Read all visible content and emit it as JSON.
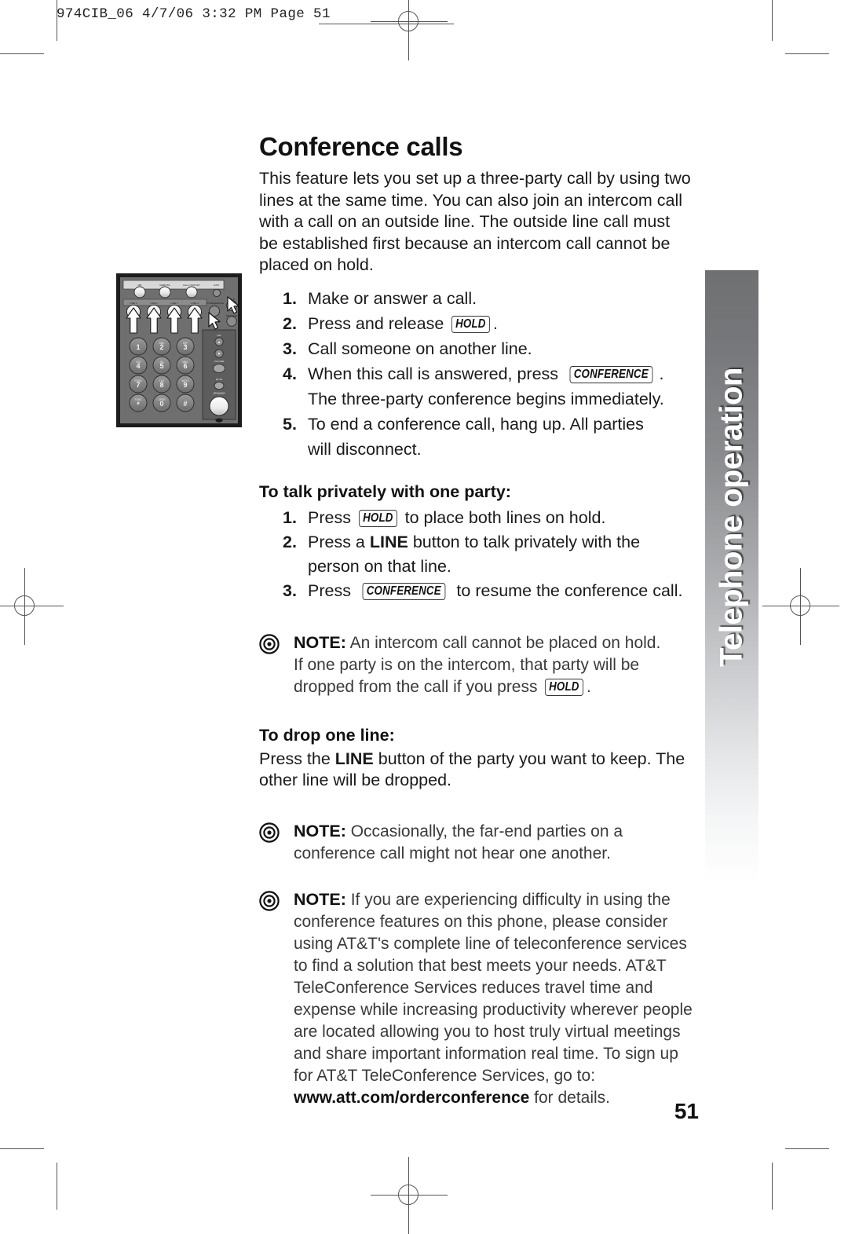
{
  "print_slug": "974CIB_06  4/7/06  3:32 PM  Page 51",
  "page_number": "51",
  "side_tab": {
    "label": "Telephone operation"
  },
  "article": {
    "title": "Conference calls",
    "intro": "This feature lets you set up a three-party call by using two lines at the same time. You can also join an intercom call with a call on an outside line. The outside line call must be established first because an intercom call cannot be placed on hold.",
    "steps": [
      {
        "num": "1.",
        "pre": "Make or answer a call.",
        "key": "",
        "post": ""
      },
      {
        "num": "2.",
        "pre": "Press and release ",
        "key": "HOLD",
        "post": "."
      },
      {
        "num": "3.",
        "pre": "Call someone on another line.",
        "key": "",
        "post": ""
      },
      {
        "num": "4.",
        "pre": "When this call is answered, press ",
        "key": "CONFERENCE",
        "post": ".",
        "cont": "The three-party conference begins immediately."
      },
      {
        "num": "5.",
        "pre": "To end a conference call, hang up.  All parties",
        "key": "",
        "post": "",
        "cont": "will disconnect."
      }
    ],
    "private_heading": "To talk privately with one party:",
    "private_steps": [
      {
        "num": "1.",
        "pre": "Press ",
        "key": "HOLD",
        "post": " to place both lines on hold."
      },
      {
        "num": "2.",
        "pre": "Press a ",
        "strong": "LINE",
        "post": " button to talk privately with the",
        "cont": "person on that line."
      },
      {
        "num": "3.",
        "pre": "Press ",
        "key": "CONFERENCE",
        "post": " to resume the conference call."
      }
    ],
    "note_hold": {
      "label": "NOTE:",
      "line1": " An intercom call cannot be placed on hold.",
      "line2": "If one party is on the intercom,  that party will be",
      "line3_pre": "dropped from the call if you press ",
      "line3_key": "HOLD",
      "line3_post": "."
    },
    "drop_heading": "To drop one line:",
    "drop_body_pre": "Press the ",
    "drop_body_strong": "LINE",
    "drop_body_post": " button of the party you want to keep. The other line will be dropped.",
    "note_farend": {
      "label": "NOTE:",
      "text": " Occasionally,  the far-end parties on a conference call might not hear one another."
    },
    "note_teleconf": {
      "label": "NOTE:",
      "text": " If you are experiencing difficulty in using the conference features on this phone,  please consider using AT&T's complete line of teleconference services to find a solution that best meets your needs.  AT&T TeleConference Services reduces travel time and expense while increasing productivity wherever people are located allowing you to host truly virtual meetings and share important information real time. To sign up for AT&T TeleConference Services,  go to:",
      "url": "www.att.com/orderconference",
      "url_suffix": " for details."
    }
  },
  "phone_illustration": {
    "top_row_labels": [
      "MB",
      "REMOTE",
      "CALL HISTORY",
      "EXIT"
    ],
    "line_labels": [
      "LINE 1",
      "LINE 2",
      "LINE 3",
      "LINE 4"
    ],
    "conference_label": "CONFERENCE",
    "hold_label": "HOLD",
    "transfer_label": "TRANSFER",
    "volume_label": "VOLUME",
    "mute_label": "MUTE",
    "speaker_label": "SPEAKER",
    "keys": [
      {
        "digit": "1",
        "letters": ""
      },
      {
        "digit": "2",
        "letters": "ABC"
      },
      {
        "digit": "3",
        "letters": "DEF"
      },
      {
        "digit": "4",
        "letters": "GHI"
      },
      {
        "digit": "5",
        "letters": "JKL"
      },
      {
        "digit": "6",
        "letters": "MNO"
      },
      {
        "digit": "7",
        "letters": "PQRS"
      },
      {
        "digit": "8",
        "letters": "TUV"
      },
      {
        "digit": "9",
        "letters": "WXYZ"
      },
      {
        "digit": "*",
        "letters": "TONE"
      },
      {
        "digit": "0",
        "letters": "OPER"
      },
      {
        "digit": "#",
        "letters": ""
      }
    ]
  }
}
